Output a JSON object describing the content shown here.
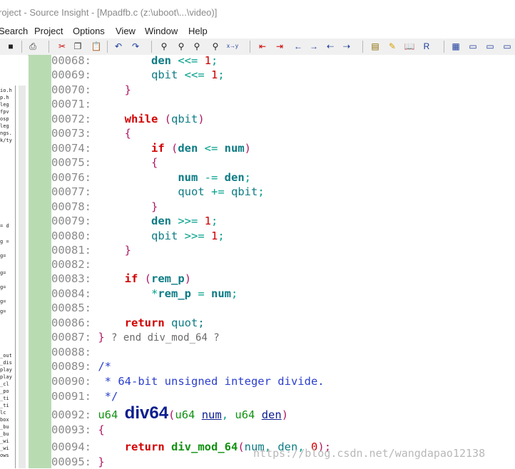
{
  "window": {
    "title": "roject - Source Insight - [Mpadfb.c (z:\\uboot\\...\\video)]"
  },
  "menu": [
    "Search",
    "Project",
    "Options",
    "View",
    "Window",
    "Help"
  ],
  "toolbar": [
    {
      "name": "save-icon",
      "glyph": "■"
    },
    {
      "name": "print-icon",
      "glyph": "⎙"
    },
    {
      "name": "cut-icon",
      "glyph": "✂"
    },
    {
      "name": "copy-icon",
      "glyph": "❐"
    },
    {
      "name": "paste-icon",
      "glyph": "📋"
    },
    {
      "name": "undo-icon",
      "glyph": "↶"
    },
    {
      "name": "redo-icon",
      "glyph": "↷"
    },
    {
      "name": "find-icon",
      "glyph": "⚲"
    },
    {
      "name": "find-next-icon",
      "glyph": "⚲"
    },
    {
      "name": "find-prev-icon",
      "glyph": "⚲"
    },
    {
      "name": "replace-icon",
      "glyph": "⚲"
    },
    {
      "name": "xref-icon",
      "glyph": "x→y"
    },
    {
      "name": "bookmark-prev-icon",
      "glyph": "⇤"
    },
    {
      "name": "bookmark-next-icon",
      "glyph": "⇥"
    },
    {
      "name": "back-icon",
      "glyph": "←"
    },
    {
      "name": "forward-icon",
      "glyph": "→"
    },
    {
      "name": "jump-prev-icon",
      "glyph": "⇠"
    },
    {
      "name": "jump-next-icon",
      "glyph": "⇢"
    },
    {
      "name": "symbol-window-icon",
      "glyph": "▤"
    },
    {
      "name": "highlight-icon",
      "glyph": "✎"
    },
    {
      "name": "reference-book-icon",
      "glyph": "📖"
    },
    {
      "name": "relation-icon",
      "glyph": "R"
    },
    {
      "name": "layout-1-icon",
      "glyph": "▦"
    },
    {
      "name": "layout-2-icon",
      "glyph": "▭"
    },
    {
      "name": "layout-3-icon",
      "glyph": "▭"
    },
    {
      "name": "layout-4-icon",
      "glyph": "▭"
    }
  ],
  "left_panel": {
    "fragments": [
      "io.h",
      "p.h",
      "leg",
      "fpv",
      "osp",
      "leg",
      "ngs.",
      "k/ty",
      "= d",
      "g =",
      "g=",
      "g=",
      "g=",
      "g=",
      "g=",
      "_out",
      "_dis",
      "play",
      "play",
      "_cl",
      "_po",
      "_ti",
      "_ti",
      "lc",
      "box",
      "_bu",
      "_bu",
      "_wi",
      "_wi",
      "ows"
    ]
  },
  "code": [
    {
      "n": "00068:",
      "t": [
        [
          "        ",
          ""
        ],
        [
          "den",
          "var"
        ],
        [
          " <<= ",
          "op"
        ],
        [
          "1",
          "num"
        ],
        [
          ";",
          "op"
        ]
      ]
    },
    {
      "n": "00069:",
      "t": [
        [
          "        ",
          ""
        ],
        [
          "qbit",
          "plain"
        ],
        [
          " <<= ",
          "op"
        ],
        [
          "1",
          "num"
        ],
        [
          ";",
          "op"
        ]
      ]
    },
    {
      "n": "00070:",
      "t": [
        [
          "    ",
          ""
        ],
        [
          "}",
          "brace"
        ]
      ]
    },
    {
      "n": "00071:",
      "t": []
    },
    {
      "n": "00072:",
      "t": [
        [
          "    ",
          ""
        ],
        [
          "while",
          "kw"
        ],
        [
          " (",
          "brace"
        ],
        [
          "qbit",
          "plain"
        ],
        [
          ")",
          "brace"
        ]
      ]
    },
    {
      "n": "00073:",
      "t": [
        [
          "    ",
          ""
        ],
        [
          "{",
          "brace"
        ]
      ]
    },
    {
      "n": "00074:",
      "t": [
        [
          "        ",
          ""
        ],
        [
          "if",
          "kw"
        ],
        [
          " (",
          "brace"
        ],
        [
          "den",
          "var"
        ],
        [
          " <= ",
          "op"
        ],
        [
          "num",
          "var"
        ],
        [
          ")",
          "brace"
        ]
      ]
    },
    {
      "n": "00075:",
      "t": [
        [
          "        ",
          ""
        ],
        [
          "{",
          "brace"
        ]
      ]
    },
    {
      "n": "00076:",
      "t": [
        [
          "            ",
          ""
        ],
        [
          "num",
          "var"
        ],
        [
          " -= ",
          "op"
        ],
        [
          "den",
          "var"
        ],
        [
          ";",
          "op"
        ]
      ]
    },
    {
      "n": "00077:",
      "t": [
        [
          "            ",
          ""
        ],
        [
          "quot",
          "plain"
        ],
        [
          " += ",
          "op"
        ],
        [
          "qbit",
          "plain"
        ],
        [
          ";",
          "op"
        ]
      ]
    },
    {
      "n": "00078:",
      "t": [
        [
          "        ",
          ""
        ],
        [
          "}",
          "brace"
        ]
      ]
    },
    {
      "n": "00079:",
      "t": [
        [
          "        ",
          ""
        ],
        [
          "den",
          "var"
        ],
        [
          " >>= ",
          "op"
        ],
        [
          "1",
          "num"
        ],
        [
          ";",
          "op"
        ]
      ]
    },
    {
      "n": "00080:",
      "t": [
        [
          "        ",
          ""
        ],
        [
          "qbit",
          "plain"
        ],
        [
          " >>= ",
          "op"
        ],
        [
          "1",
          "num"
        ],
        [
          ";",
          "op"
        ]
      ]
    },
    {
      "n": "00081:",
      "t": [
        [
          "    ",
          ""
        ],
        [
          "}",
          "brace"
        ]
      ]
    },
    {
      "n": "00082:",
      "t": []
    },
    {
      "n": "00083:",
      "t": [
        [
          "    ",
          ""
        ],
        [
          "if",
          "kw"
        ],
        [
          " (",
          "brace"
        ],
        [
          "rem_p",
          "var"
        ],
        [
          ")",
          "brace"
        ]
      ]
    },
    {
      "n": "00084:",
      "t": [
        [
          "        ",
          ""
        ],
        [
          "*",
          "op"
        ],
        [
          "rem_p",
          "var"
        ],
        [
          " = ",
          "op"
        ],
        [
          "num",
          "var"
        ],
        [
          ";",
          "op"
        ]
      ]
    },
    {
      "n": "00085:",
      "t": []
    },
    {
      "n": "00086:",
      "t": [
        [
          "    ",
          ""
        ],
        [
          "return",
          "kw"
        ],
        [
          " quot;",
          "plain"
        ]
      ]
    },
    {
      "n": "00087:",
      "t": [
        [
          "} ",
          "brace"
        ],
        [
          "? end div_mod_64 ?",
          "endc"
        ]
      ]
    },
    {
      "n": "00088:",
      "t": []
    },
    {
      "n": "00089:",
      "t": [
        [
          "/*",
          "cmt"
        ]
      ]
    },
    {
      "n": "00090:",
      "t": [
        [
          " * 64-bit unsigned integer divide.",
          "cmt"
        ]
      ]
    },
    {
      "n": "00091:",
      "t": [
        [
          " */",
          "cmt"
        ]
      ]
    },
    {
      "n": "00092:",
      "t": [
        [
          "u64 ",
          "type"
        ],
        [
          "div64",
          "fn"
        ],
        [
          "(",
          "brace"
        ],
        [
          "u64 ",
          "type"
        ],
        [
          "num",
          "param"
        ],
        [
          ", ",
          "op"
        ],
        [
          "u64 ",
          "type"
        ],
        [
          "den",
          "param"
        ],
        [
          ")",
          "brace"
        ]
      ]
    },
    {
      "n": "00093:",
      "t": [
        [
          "{",
          "brace"
        ]
      ]
    },
    {
      "n": "00094:",
      "t": [
        [
          "    ",
          ""
        ],
        [
          "return ",
          "kw"
        ],
        [
          "div_mod_64",
          "callfn"
        ],
        [
          "(",
          "brace"
        ],
        [
          "num",
          "plain"
        ],
        [
          ", ",
          "op"
        ],
        [
          "den",
          "plain"
        ],
        [
          ", ",
          "op"
        ],
        [
          "0",
          "num"
        ],
        [
          ");",
          "brace"
        ]
      ]
    },
    {
      "n": "00095:",
      "t": [
        [
          "}",
          "brace"
        ]
      ]
    }
  ],
  "watermark": "https://blog.csdn.net/wangdapao12138"
}
